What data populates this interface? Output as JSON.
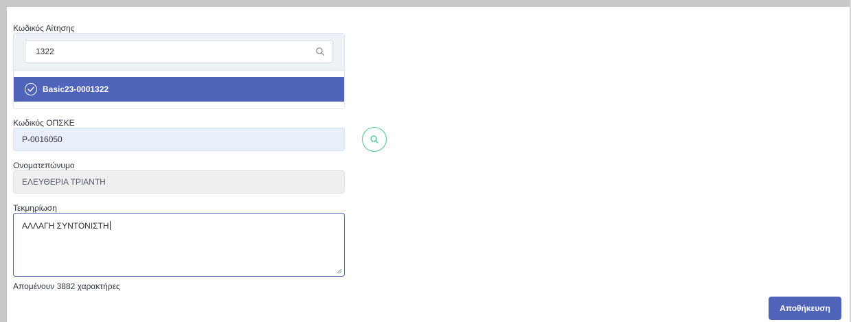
{
  "form": {
    "application_code": {
      "label": "Κωδικός Αίτησης",
      "search_value": "1322",
      "selected_option": "Basic23-0001322"
    },
    "opske_code": {
      "label": "Κωδικός ΟΠΣΚΕ",
      "value": "P-0016050"
    },
    "full_name": {
      "label": "Ονοματεπώνυμο",
      "value": "ΕΛΕΥΘΕΡΙΑ ΤΡΙΑΝΤΗ"
    },
    "justification": {
      "label": "Τεκμηρίωση",
      "value": "ΑΛΛΑΓΗ ΣΥΝΤΟΝΙΣΤΗ",
      "remaining_text": "Απομένουν 3882 χαρακτήρες"
    },
    "save_label": "Αποθήκευση"
  },
  "colors": {
    "primary": "#4f63b8",
    "accent_green": "#4cc58a",
    "input_blue_bg": "#e8effb",
    "input_disabled_bg": "#efefef"
  },
  "icons": [
    "search-icon",
    "check-circle-icon",
    "resize-grip-icon"
  ]
}
